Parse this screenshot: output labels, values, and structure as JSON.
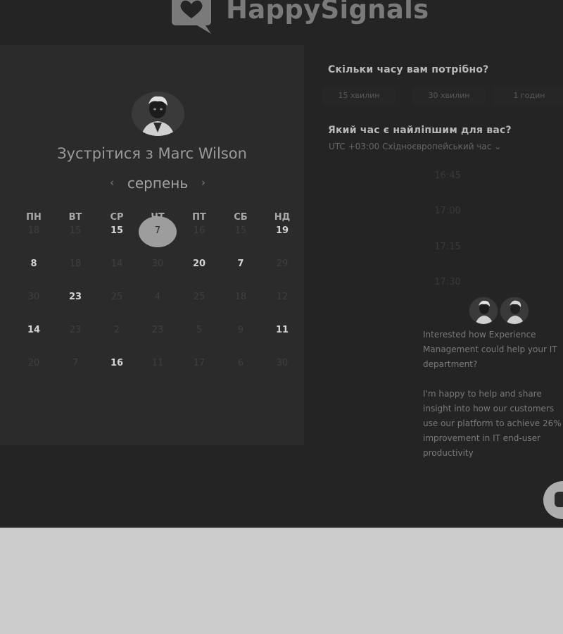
{
  "header": {
    "brand": "HappySignals"
  },
  "left": {
    "meet_title": "Зустрітися з Marc Wilson",
    "month": "серпень",
    "weekdays": [
      "ПН",
      "ВТ",
      "СР",
      "ЧТ",
      "ПТ",
      "СБ",
      "НД"
    ],
    "weeks": [
      [
        {
          "d": "18",
          "on": false
        },
        {
          "d": "15",
          "on": false
        },
        {
          "d": "15",
          "on": true
        },
        {
          "d": "7",
          "on": true,
          "selected": true
        },
        {
          "d": "16",
          "on": false
        },
        {
          "d": "15",
          "on": false
        },
        {
          "d": "19",
          "on": true
        }
      ],
      [
        {
          "d": "8",
          "on": true
        },
        {
          "d": "18",
          "on": false
        },
        {
          "d": "14",
          "on": false
        },
        {
          "d": "30",
          "on": false
        },
        {
          "d": "20",
          "on": true
        },
        {
          "d": "7",
          "on": true
        },
        {
          "d": "29",
          "on": false
        }
      ],
      [
        {
          "d": "30",
          "on": false
        },
        {
          "d": "23",
          "on": true
        },
        {
          "d": "25",
          "on": false
        },
        {
          "d": "4",
          "on": false
        },
        {
          "d": "25",
          "on": false
        },
        {
          "d": "18",
          "on": false
        },
        {
          "d": "12",
          "on": false
        }
      ],
      [
        {
          "d": "14",
          "on": true
        },
        {
          "d": "23",
          "on": false
        },
        {
          "d": "2",
          "on": false
        },
        {
          "d": "23",
          "on": false
        },
        {
          "d": "5",
          "on": false
        },
        {
          "d": "9",
          "on": false
        },
        {
          "d": "11",
          "on": true
        }
      ],
      [
        {
          "d": "20",
          "on": false
        },
        {
          "d": "7",
          "on": false
        },
        {
          "d": "16",
          "on": true
        },
        {
          "d": "11",
          "on": false
        },
        {
          "d": "17",
          "on": false
        },
        {
          "d": "6",
          "on": false
        },
        {
          "d": "30",
          "on": false
        }
      ]
    ]
  },
  "right": {
    "duration_question": "Скільки часу вам потрібно?",
    "durations": [
      "15 хвилин",
      "30 хвилин",
      "1 годин"
    ],
    "time_question": "Який час є найліпшим для вас?",
    "timezone": "UTC +03:00 Східноєвропейський час",
    "slots": [
      "16:45",
      "17:00",
      "17:15",
      "17:30"
    ]
  },
  "chat": {
    "message": "Interested how Experience\nManagement could help your IT\ndepartment?\n\nI'm happy to help and share\ninsight into how our customers\nuse our platform to achieve 26%\nimprovement in IT end-user\nproductivity"
  },
  "icons": {
    "logo": "heart-speech-bubble-icon",
    "prev": "chevron-left-icon",
    "next": "chevron-right-icon",
    "timezone": "caret-down-icon",
    "launcher": "chat-icon"
  }
}
